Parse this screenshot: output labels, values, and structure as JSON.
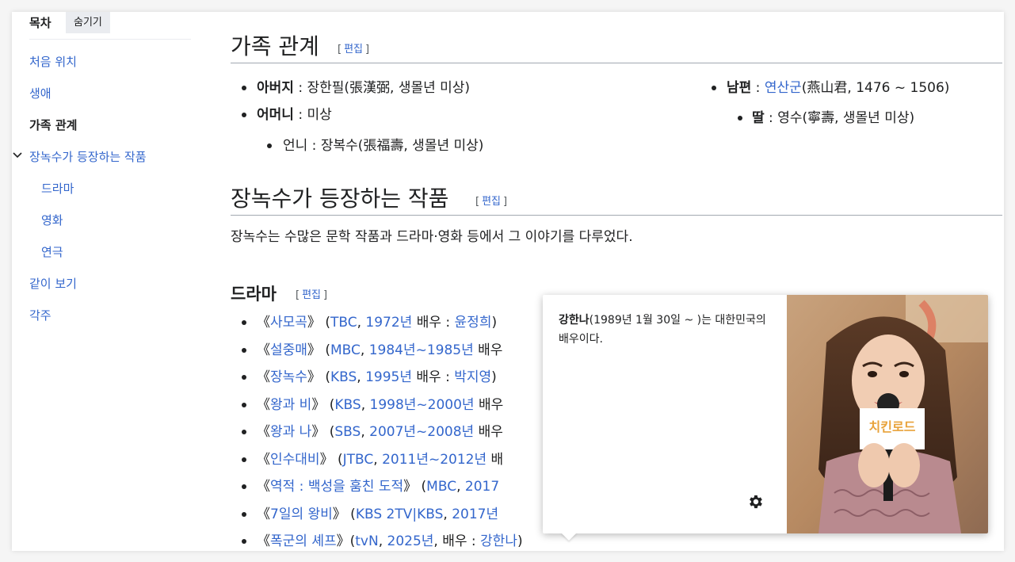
{
  "toc": {
    "title": "목차",
    "hide_label": "숨기기",
    "items": [
      {
        "label": "처음 위치"
      },
      {
        "label": "생애"
      },
      {
        "label": "가족 관계"
      },
      {
        "label": "장녹수가 등장하는 작품"
      },
      {
        "label": "드라마"
      },
      {
        "label": "영화"
      },
      {
        "label": "연극"
      },
      {
        "label": "같이 보기"
      },
      {
        "label": "각주"
      }
    ]
  },
  "edit": {
    "open": "[",
    "label": "편집",
    "close": "]"
  },
  "family": {
    "heading": "가족 관계",
    "left": [
      {
        "label": "아버지",
        "sep": " : ",
        "value": "장한필(張漢弼, 생몰년 미상)"
      },
      {
        "label": "어머니",
        "sep": " : ",
        "value": "미상"
      },
      {
        "label": "",
        "sep": "",
        "value": "언니 : 장복수(張福壽, 생몰년 미상)"
      }
    ],
    "right": [
      {
        "label": "남편",
        "sep": " : ",
        "link": "연산군",
        "value": "(燕山君, 1476 ~ 1506)"
      },
      {
        "label": "딸",
        "sep": " : ",
        "value": "영수(寧壽, 생몰년 미상)"
      }
    ]
  },
  "works": {
    "heading": "장녹수가 등장하는 작품",
    "intro": "장녹수는 수많은 문학 작품과 드라마·영화 등에서 그 이야기를 다루었다.",
    "drama_heading": "드라마",
    "dramas": [
      {
        "open": "《",
        "title": "사모곡",
        "close": "》 (",
        "network": "TBC",
        "sep1": ", ",
        "year": "1972년",
        "rest": " 배우 : ",
        "actor": "윤정희",
        "end": ")"
      },
      {
        "open": "《",
        "title": "설중매",
        "close": "》 (",
        "network": "MBC",
        "sep1": ", ",
        "year": "1984년~1985년",
        "rest": " 배우",
        "actor": "",
        "end": ""
      },
      {
        "open": "《",
        "title": "장녹수",
        "close": "》 (",
        "network": "KBS",
        "sep1": ", ",
        "year": "1995년",
        "rest": " 배우 : ",
        "actor": "박지영",
        "end": ")"
      },
      {
        "open": "《",
        "title": "왕과 비",
        "close": "》 (",
        "network": "KBS",
        "sep1": ", ",
        "year": "1998년~2000년",
        "rest": " 배우",
        "actor": "",
        "end": ""
      },
      {
        "open": "《",
        "title": "왕과 나",
        "close": "》 (",
        "network": "SBS",
        "sep1": ", ",
        "year": "2007년~2008년",
        "rest": " 배우",
        "actor": "",
        "end": ""
      },
      {
        "open": "《",
        "title": "인수대비",
        "close": "》 (",
        "network": "JTBC",
        "sep1": ", ",
        "year": "2011년~2012년",
        "rest": " 배",
        "actor": "",
        "end": ""
      },
      {
        "open": "《",
        "title": "역적 : 백성을 훔친 도적",
        "close": "》 (",
        "network": "MBC",
        "sep1": ", ",
        "year": "2017",
        "rest": "",
        "actor": "",
        "end": ""
      },
      {
        "open": "《",
        "title": "7일의 왕비",
        "close": "》 (",
        "network": "KBS 2TV|KBS",
        "sep1": ", ",
        "year": "2017년",
        "rest": "",
        "actor": "",
        "end": ""
      },
      {
        "open": "《",
        "title": "폭군의 셰프",
        "close": "》(",
        "network": "tvN",
        "sep1": ", ",
        "year": "2025년",
        "rest": ", 배우 : ",
        "actor": "강한나",
        "end": ")"
      }
    ]
  },
  "popup": {
    "name": "강한나",
    "text": "(1989년 1월 30일 ~ )는 대한민국의 배우이다.",
    "image_badge": "치킨로드"
  }
}
